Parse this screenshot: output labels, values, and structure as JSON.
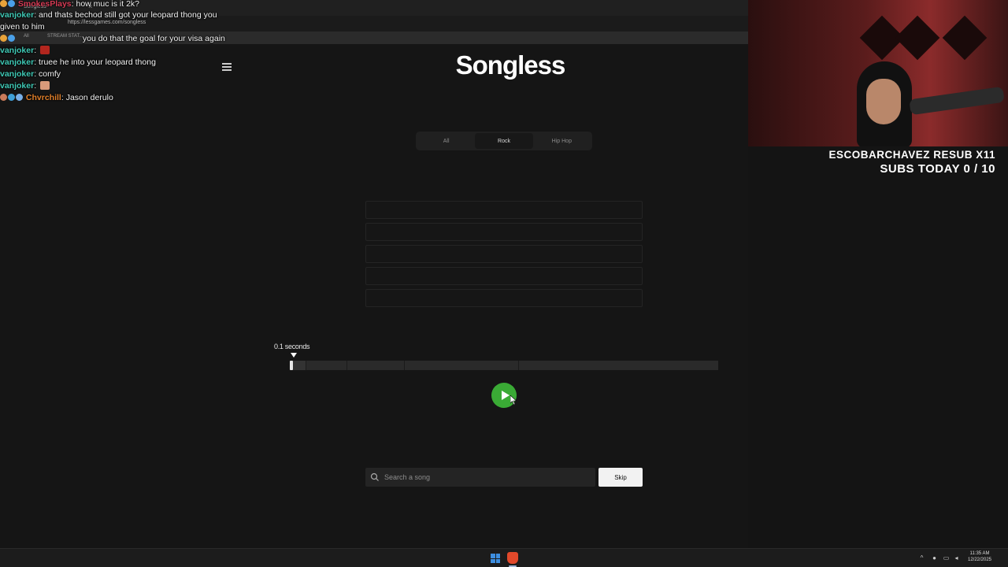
{
  "browser": {
    "tab_title": "Songless",
    "tab_close": "×",
    "url": "https://lessgames.com/songless",
    "bookmarks": [
      "All",
      "STREAM STAT..."
    ]
  },
  "app": {
    "logo": "Songless",
    "genres": [
      {
        "label": "All",
        "active": false
      },
      {
        "label": "Rock",
        "active": true
      },
      {
        "label": "Hip Hop",
        "active": false
      }
    ],
    "guess_slots": 5,
    "clip_length_label": "0.1 seconds",
    "clip_progress_fraction": 0.008,
    "search_placeholder": "Search a song",
    "skip_label": "Skip"
  },
  "chat": [
    {
      "user": "SmokesPlays",
      "user_color": "#d63b55",
      "message": "how muc is it 2k?"
    },
    {
      "user": "vanjoker",
      "user_color": "#3fc9b5",
      "message": "and thats bechod still got your leopard thong you"
    },
    {
      "user": "",
      "user_color": "#3fc9b5",
      "message": "given to him"
    },
    {
      "user": "",
      "user_color": "#d63b55",
      "message": "you do that the goal for your visa again"
    },
    {
      "user": "vanjoker",
      "user_color": "#3fc9b5",
      "message": ""
    },
    {
      "user": "vanjoker",
      "user_color": "#3fc9b5",
      "message": "truee he into your leopard thong"
    },
    {
      "user": "vanjoker",
      "user_color": "#3fc9b5",
      "message": "comfy"
    },
    {
      "user": "vanjoker",
      "user_color": "#3fc9b5",
      "message": ""
    },
    {
      "user": "Chvrchill",
      "user_color": "#e07f2a",
      "message": "Jason derulo"
    }
  ],
  "overlay": {
    "resub_text": "ESCOBARCHAVEZ RESUB X11",
    "subs_today": "SUBS TODAY 0 / 10"
  },
  "taskbar": {
    "time": "11:35 AM",
    "date": "12/22/2025"
  },
  "colors": {
    "accent_green": "#3aaa35",
    "background": "#151515"
  }
}
